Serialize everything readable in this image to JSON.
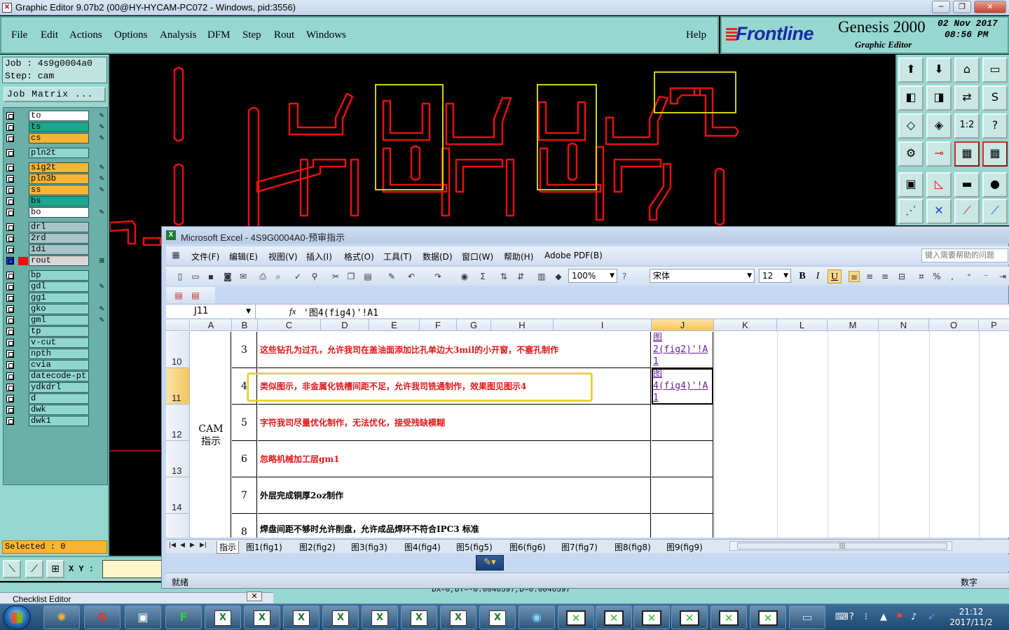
{
  "genesis": {
    "window_title": "Graphic Editor 9.07b2 (00@HY-HYCAM-PC072 - Windows, pid:3556)",
    "menu": [
      "File",
      "Edit",
      "Actions",
      "Options",
      "Analysis",
      "DFM",
      "Step",
      "Rout",
      "Windows"
    ],
    "help": "Help",
    "brand": {
      "logo": "Frontline",
      "product": "Genesis 2000",
      "subtitle": "Graphic Editor",
      "date": "02 Nov 2017",
      "time": "08:56 PM"
    },
    "job": "Job : 4s9g0004a0",
    "step": "Step: cam",
    "job_matrix": "Job Matrix ...",
    "layers": [
      {
        "name": "to",
        "color": "#ffffff",
        "edit": true
      },
      {
        "name": "ts",
        "color": "#19a78f",
        "edit": true
      },
      {
        "name": "cs",
        "color": "#f7b533",
        "edit": true
      },
      {
        "name": "pln2t",
        "color": "#8fd6cf",
        "edit": false
      },
      {
        "name": "sig2t",
        "color": "#f7b533",
        "edit": true
      },
      {
        "name": "pln3b",
        "color": "#f7b533",
        "edit": true
      },
      {
        "name": "ss",
        "color": "#f7b533",
        "edit": true
      },
      {
        "name": "bs",
        "color": "#19a78f",
        "edit": false
      },
      {
        "name": "bo",
        "color": "#ffffff",
        "edit": true
      },
      {
        "name": "drl",
        "color": "#a8c4c8",
        "edit": false
      },
      {
        "name": "2rd",
        "color": "#a8c4c8",
        "edit": false
      },
      {
        "name": "1di",
        "color": "#a8c4c8",
        "edit": false
      },
      {
        "name": "rout",
        "color": "#d8d8d8",
        "edit": true,
        "active": true
      },
      {
        "name": "bp",
        "color": "#8fd6cf",
        "edit": false
      },
      {
        "name": "gdl",
        "color": "#8fd6cf",
        "edit": true
      },
      {
        "name": "gg1",
        "color": "#8fd6cf",
        "edit": false
      },
      {
        "name": "gko",
        "color": "#8fd6cf",
        "edit": true
      },
      {
        "name": "gml",
        "color": "#8fd6cf",
        "edit": true
      },
      {
        "name": "tp",
        "color": "#8fd6cf",
        "edit": false
      },
      {
        "name": "v-cut",
        "color": "#8fd6cf",
        "edit": false
      },
      {
        "name": "npth",
        "color": "#8fd6cf",
        "edit": false
      },
      {
        "name": "cvia",
        "color": "#8fd6cf",
        "edit": false
      },
      {
        "name": "datecode-pt",
        "color": "#8fd6cf",
        "edit": false
      },
      {
        "name": "ydkdrl",
        "color": "#8fd6cf",
        "edit": false
      },
      {
        "name": "d",
        "color": "#8fd6cf",
        "edit": false
      },
      {
        "name": "dwk",
        "color": "#8fd6cf",
        "edit": false
      },
      {
        "name": "dwk1",
        "color": "#8fd6cf",
        "edit": false
      }
    ],
    "selected": "Selected : 0",
    "xy_label": "X Y :",
    "status_coords": "DX=0,DY=-0.0046597,D=0.0046597",
    "checklist": "Checklist Editor",
    "colors": {
      "panel": "#96d7d0",
      "route": "#e81010",
      "selection_box": "#e6e615"
    }
  },
  "excel": {
    "window_title": "Microsoft Excel - 4S9G0004A0-预审指示",
    "menu": [
      "文件(F)",
      "编辑(E)",
      "视图(V)",
      "插入(I)",
      "格式(O)",
      "工具(T)",
      "数据(D)",
      "窗口(W)",
      "帮助(H)",
      "Adobe PDF(B)"
    ],
    "help_placeholder": "键入需要帮助的问题",
    "zoom": "100%",
    "font": "宋体",
    "font_size": "12",
    "name_box": "J11",
    "formula": "'图4(fig4)'!A1",
    "columns": [
      "A",
      "B",
      "C",
      "D",
      "E",
      "F",
      "G",
      "H",
      "I",
      "J",
      "K",
      "L",
      "M",
      "N",
      "O",
      "P"
    ],
    "selected_column": "J",
    "section_label": [
      "CAM",
      "指示"
    ],
    "rows": [
      {
        "row": "10",
        "no": "3",
        "text": "这些钻孔为过孔，允许我司在盖油面添加比孔单边大3mil的小开窗，不塞孔制作",
        "color": "red",
        "link": [
          "图",
          "2(fig2)'!A",
          "1"
        ]
      },
      {
        "row": "11",
        "no": "4",
        "text": "类似图示，非金属化铣槽间距不足，允许我司铣通制作，效果图见图示4",
        "color": "red",
        "link": [
          "图",
          "4(fig4)'!A",
          "1"
        ],
        "active": true
      },
      {
        "row": "12",
        "no": "5",
        "text": "字符我司尽量优化制作，无法优化，接受残缺模糊",
        "color": "red",
        "link": []
      },
      {
        "row": "13",
        "no": "6",
        "text": "忽略机械加工层gm1",
        "color": "red",
        "link": []
      },
      {
        "row": "14",
        "no": "7",
        "text": "外层完成铜厚2oz制作",
        "color": "black",
        "link": []
      },
      {
        "row": "",
        "no": "8",
        "text": "焊盘间距不够时允许削盘，允许成品焊环不符合IPC3 标准",
        "color": "black",
        "link": []
      }
    ],
    "sheet_tabs": [
      "指示",
      "图1(fig1)",
      "图2(fig2)",
      "图3(fig3)",
      "图4(fig4)",
      "图5(fig5)",
      "图6(fig6)",
      "图7(fig7)",
      "图8(fig8)",
      "图9(fig9)"
    ],
    "status_left": "就绪",
    "status_right": "数字"
  },
  "taskbar": {
    "clock_time": "21:12",
    "clock_date": "2017/11/2"
  }
}
